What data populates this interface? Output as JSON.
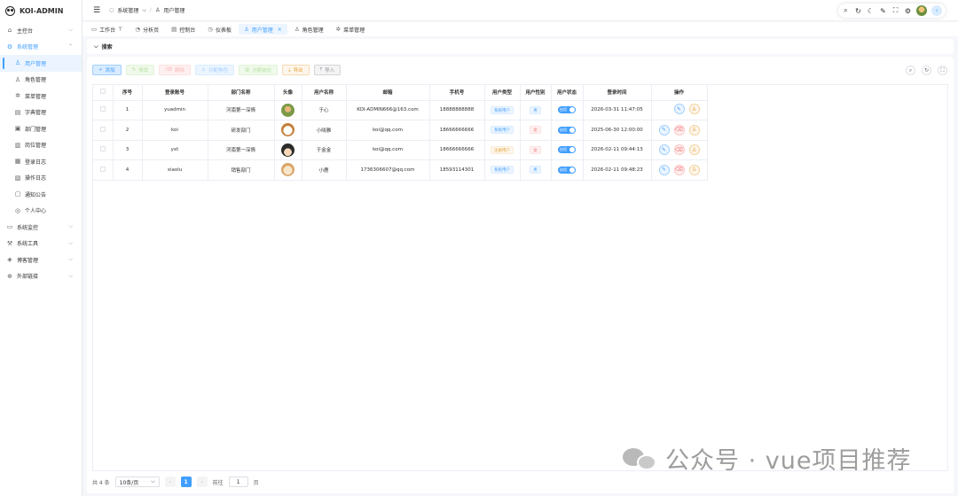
{
  "app": {
    "title": "KOI-ADMIN"
  },
  "sidebar": {
    "items": [
      {
        "label": "主控台",
        "icon": "home-icon",
        "chev": "⌵"
      },
      {
        "label": "系统管理",
        "icon": "gear-icon",
        "chev": "⌃"
      },
      {
        "label": "用户管理",
        "icon": "user-icon"
      },
      {
        "label": "角色管理",
        "icon": "role-icon"
      },
      {
        "label": "菜单管理",
        "icon": "menu-icon"
      },
      {
        "label": "字典管理",
        "icon": "dict-icon"
      },
      {
        "label": "部门管理",
        "icon": "dept-icon"
      },
      {
        "label": "岗位管理",
        "icon": "post-icon"
      },
      {
        "label": "登录日志",
        "icon": "login-log-icon"
      },
      {
        "label": "操作日志",
        "icon": "op-log-icon"
      },
      {
        "label": "通知公告",
        "icon": "notice-icon"
      },
      {
        "label": "个人中心",
        "icon": "profile-icon"
      },
      {
        "label": "系统监控",
        "icon": "monitor-icon",
        "chev": "⌵"
      },
      {
        "label": "系统工具",
        "icon": "tools-icon",
        "chev": "⌵"
      },
      {
        "label": "博客管理",
        "icon": "blog-icon",
        "chev": "⌵"
      },
      {
        "label": "外部链接",
        "icon": "link-icon",
        "chev": "⌵"
      }
    ]
  },
  "header": {
    "breadcrumb": [
      {
        "label": "系统管理"
      },
      {
        "label": "用户管理"
      }
    ]
  },
  "tabs": [
    {
      "label": "工作台"
    },
    {
      "label": "分析页"
    },
    {
      "label": "控制台"
    },
    {
      "label": "仪表板"
    },
    {
      "label": "用户管理",
      "close": "×"
    },
    {
      "label": "角色管理"
    },
    {
      "label": "菜单管理"
    }
  ],
  "search": {
    "label": "搜索"
  },
  "buttons": {
    "add": "添加",
    "edit": "修改",
    "delete": "删除",
    "assign_role": "分配角色",
    "assign_post": "分配岗位",
    "export": "导出",
    "import": "导入"
  },
  "table": {
    "headers": [
      "",
      "序号",
      "登录账号",
      "部门名称",
      "头像",
      "用户名称",
      "邮箱",
      "手机号",
      "用户类型",
      "用户性别",
      "用户状态",
      "登录时间",
      "操作"
    ],
    "rows": [
      {
        "index": "1",
        "account": "yuadmin",
        "dept": "河南第一深情",
        "name": "于心",
        "email": "KOI-ADMIN666@163.com",
        "phone": "18888888888",
        "type": "系统用户",
        "gender": "男",
        "status": "启用",
        "login_time": "2026-03-31 11:47:05"
      },
      {
        "index": "2",
        "account": "koi",
        "dept": "研发部门",
        "name": "小晓雅",
        "email": "koi@qq.com",
        "phone": "18666666666",
        "type": "系统用户",
        "gender": "女",
        "status": "启用",
        "login_time": "2025-06-30 12:00:00"
      },
      {
        "index": "3",
        "account": "yxt",
        "dept": "河南第一深情",
        "name": "于金金",
        "email": "koi@qq.com",
        "phone": "18666666666",
        "type": "注册用户",
        "gender": "女",
        "status": "启用",
        "login_time": "2026-02-11 09:44:13"
      },
      {
        "index": "4",
        "account": "xiaolu",
        "dept": "销售部门",
        "name": "小鹿",
        "email": "1736306607@qq.com",
        "phone": "18593114301",
        "type": "系统用户",
        "gender": "男",
        "status": "启用",
        "login_time": "2026-02-11 09:48:23"
      }
    ]
  },
  "pagination": {
    "total": "共 4 条",
    "page_size": "10条/页",
    "current": "1",
    "goto_label": "前往",
    "goto_value": "1",
    "page_suffix": "页"
  },
  "watermark": {
    "text": "公众号 · vue项目推荐"
  },
  "colors": {
    "primary": "#409eff",
    "danger": "#f56c6c",
    "warning": "#e6a23c"
  }
}
